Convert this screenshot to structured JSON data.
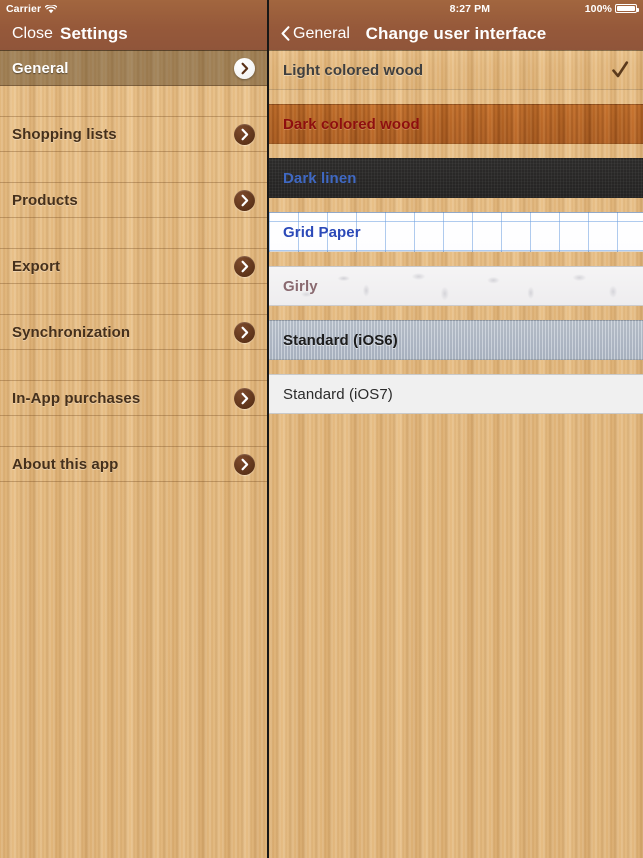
{
  "left_panel": {
    "status_bar": {
      "carrier": "Carrier",
      "wifi_icon": "wifi-icon"
    },
    "nav": {
      "close_label": "Close",
      "title": "Settings"
    },
    "items": [
      {
        "label": "General",
        "selected": true,
        "accessory": "chevron-right-icon"
      },
      {
        "label": "Shopping lists",
        "selected": false,
        "accessory": "chevron-right-icon"
      },
      {
        "label": "Products",
        "selected": false,
        "accessory": "chevron-right-icon"
      },
      {
        "label": "Export",
        "selected": false,
        "accessory": "chevron-right-icon"
      },
      {
        "label": "Synchronization",
        "selected": false,
        "accessory": "chevron-right-icon"
      },
      {
        "label": "In-App purchases",
        "selected": false,
        "accessory": "chevron-right-icon"
      },
      {
        "label": "About this app",
        "selected": false,
        "accessory": "chevron-right-icon"
      }
    ]
  },
  "right_panel": {
    "status_bar": {
      "time": "8:27 PM",
      "battery_percent": "100%",
      "battery_icon": "battery-full-icon"
    },
    "nav": {
      "back_label": "General",
      "back_icon": "chevron-left-icon",
      "title": "Change user interface"
    },
    "themes": [
      {
        "label": "Light colored wood",
        "style": "wood-light",
        "class": "t-lightwood",
        "checked": true
      },
      {
        "label": "Dark colored wood",
        "style": "wood-dark",
        "class": "t-darkwood",
        "checked": false
      },
      {
        "label": "Dark linen",
        "style": "linen-dark",
        "class": "t-darklinen",
        "checked": false
      },
      {
        "label": "Grid Paper",
        "style": "grid-paper",
        "class": "t-gridpaper",
        "checked": false
      },
      {
        "label": "Girly",
        "style": "girly",
        "class": "t-girly",
        "checked": false
      },
      {
        "label": "Standard (iOS6)",
        "style": "ios6",
        "class": "t-ios6",
        "checked": false
      },
      {
        "label": "Standard (iOS7)",
        "style": "ios7",
        "class": "t-ios7",
        "checked": false
      }
    ]
  },
  "colors": {
    "navbar": "#96593a",
    "wood_light": "#e5b87a",
    "wood_dark": "#b8631f",
    "divider": "#171717",
    "accent_disc": "#5b3218",
    "checkmark": "#5b3a1c"
  }
}
